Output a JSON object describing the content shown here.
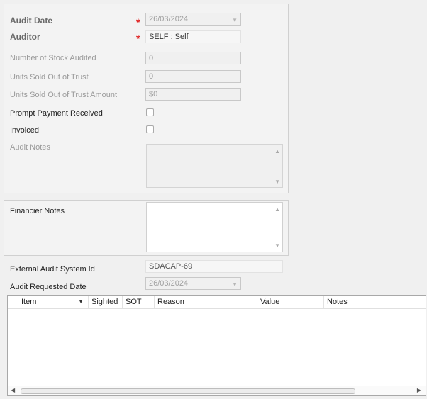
{
  "audit": {
    "audit_date_label": "Audit Date",
    "audit_date_value": "26/03/2024",
    "auditor_label": "Auditor",
    "auditor_value": "SELF : Self",
    "stock_audited_label": "Number of Stock Audited",
    "stock_audited_value": "0",
    "units_sold_label": "Units Sold Out of Trust",
    "units_sold_value": "0",
    "units_sold_amount_label": "Units Sold Out of Trust Amount",
    "units_sold_amount_value": "$0",
    "prompt_payment_label": "Prompt Payment Received",
    "prompt_payment_checked": false,
    "invoiced_label": "Invoiced",
    "invoiced_checked": false,
    "audit_notes_label": "Audit Notes",
    "audit_notes_value": ""
  },
  "financier": {
    "notes_label": "Financier Notes",
    "notes_value": ""
  },
  "external": {
    "system_id_label": "External Audit System Id",
    "system_id_value": "SDACAP-69",
    "requested_date_label": "Audit Requested Date",
    "requested_date_value": "26/03/2024"
  },
  "grid": {
    "columns": [
      "Item",
      "Sighted",
      "SOT",
      "Reason",
      "Value",
      "Notes"
    ],
    "rows": []
  },
  "colors": {
    "required": "#e02020",
    "background": "#f0f0f0"
  }
}
